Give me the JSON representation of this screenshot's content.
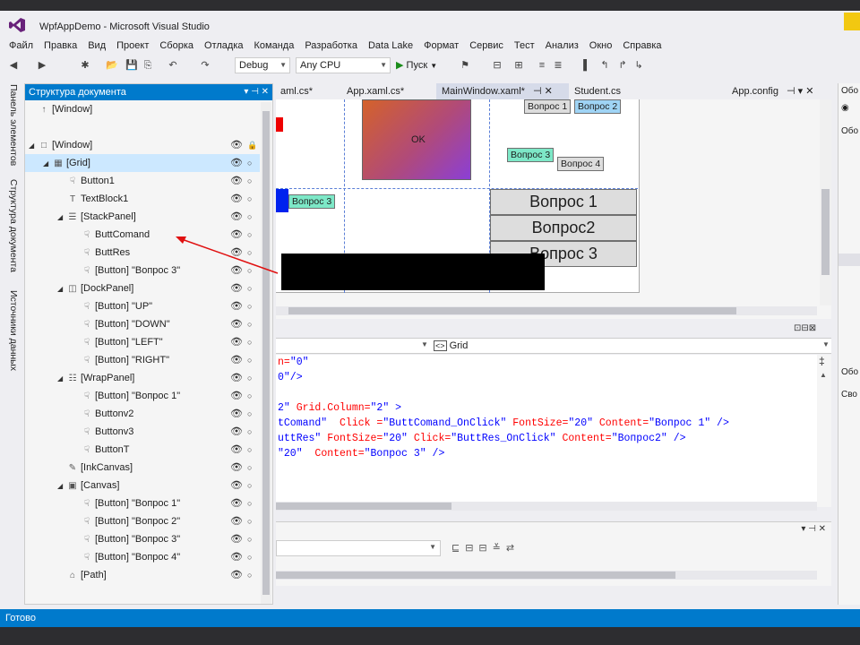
{
  "window": {
    "title": "WpfAppDemo - Microsoft Visual Studio"
  },
  "menu": [
    "Файл",
    "Правка",
    "Вид",
    "Проект",
    "Сборка",
    "Отладка",
    "Команда",
    "Разработка",
    "Data Lake",
    "Формат",
    "Сервис",
    "Тест",
    "Анализ",
    "Окно",
    "Справка"
  ],
  "toolbar": {
    "config": "Debug",
    "platform": "Any CPU",
    "run_label": "Пуск"
  },
  "vertical_tabs": [
    "Панель элементов",
    "Структура документа",
    "Источники данных"
  ],
  "outline": {
    "header": "Структура документа",
    "header_controls": "▾ ⊣ ✕",
    "items": [
      {
        "label": "[Window]",
        "indent": 0,
        "icon": "↑",
        "arrow": ""
      },
      {
        "label": "[Window]",
        "indent": 0,
        "icon": "□",
        "arrow": "◢"
      },
      {
        "label": "[Grid]",
        "indent": 1,
        "icon": "▦",
        "arrow": "◢"
      },
      {
        "label": "Button1",
        "indent": 2,
        "icon": "☟",
        "arrow": ""
      },
      {
        "label": "TextBlock1",
        "indent": 2,
        "icon": "T",
        "arrow": ""
      },
      {
        "label": "[StackPanel]",
        "indent": 2,
        "icon": "☰",
        "arrow": "◢"
      },
      {
        "label": "ButtComand",
        "indent": 3,
        "icon": "☟",
        "arrow": ""
      },
      {
        "label": "ButtRes",
        "indent": 3,
        "icon": "☟",
        "arrow": ""
      },
      {
        "label": "[Button] \"Вопрос 3\"",
        "indent": 3,
        "icon": "☟",
        "arrow": ""
      },
      {
        "label": "[DockPanel]",
        "indent": 2,
        "icon": "◫",
        "arrow": "◢"
      },
      {
        "label": "[Button] \"UP\"",
        "indent": 3,
        "icon": "☟",
        "arrow": ""
      },
      {
        "label": "[Button] \"DOWN\"",
        "indent": 3,
        "icon": "☟",
        "arrow": ""
      },
      {
        "label": "[Button] \"LEFT\"",
        "indent": 3,
        "icon": "☟",
        "arrow": ""
      },
      {
        "label": "[Button] \"RIGHT\"",
        "indent": 3,
        "icon": "☟",
        "arrow": ""
      },
      {
        "label": "[WrapPanel]",
        "indent": 2,
        "icon": "☷",
        "arrow": "◢"
      },
      {
        "label": "[Button] \"Вопрос 1\"",
        "indent": 3,
        "icon": "☟",
        "arrow": ""
      },
      {
        "label": "Buttonv2",
        "indent": 3,
        "icon": "☟",
        "arrow": ""
      },
      {
        "label": "Buttonv3",
        "indent": 3,
        "icon": "☟",
        "arrow": ""
      },
      {
        "label": "ButtonT",
        "indent": 3,
        "icon": "☟",
        "arrow": ""
      },
      {
        "label": "[InkCanvas]",
        "indent": 2,
        "icon": "✎",
        "arrow": ""
      },
      {
        "label": "[Canvas]",
        "indent": 2,
        "icon": "▣",
        "arrow": "◢"
      },
      {
        "label": "[Button] \"Вопрос 1\"",
        "indent": 3,
        "icon": "☟",
        "arrow": ""
      },
      {
        "label": "[Button] \"Вопрос 2\"",
        "indent": 3,
        "icon": "☟",
        "arrow": ""
      },
      {
        "label": "[Button] \"Вопрос 3\"",
        "indent": 3,
        "icon": "☟",
        "arrow": ""
      },
      {
        "label": "[Button] \"Вопрос 4\"",
        "indent": 3,
        "icon": "☟",
        "arrow": ""
      },
      {
        "label": "[Path]",
        "indent": 2,
        "icon": "⌂",
        "arrow": ""
      }
    ]
  },
  "tabs": {
    "t1": "aml.cs*",
    "t2": "App.xaml.cs*",
    "t3": "MainWindow.xaml*",
    "t3_ctl": "⊣ ✕",
    "t4": "Student.cs",
    "t5": "App.config",
    "t5_ctl": "⊣ ▾ ✕"
  },
  "designer": {
    "ok": "OK",
    "q1_small": "Вопрос 1",
    "q2_small": "Вопрос 2",
    "q3_small": "Вопрос 3",
    "q4_small": "Вопрос 4",
    "q3_left": "Вопрос 3",
    "big1": "Вопрос 1",
    "big2": "Вопрос2",
    "big3": "Вопрос 3"
  },
  "code_nav": {
    "element": "Grid"
  },
  "code": {
    "l1_a": "n=",
    "l1_v": "\"0\"",
    "l2_v": "0\"/>",
    "l3_a": "2\"",
    "l3_b": " Grid.Column=",
    "l3_c": "\"2\"",
    "l3_d": " >",
    "l4_a": "tComand\"",
    "l4_b": "  Click =",
    "l4_c": "\"ButtComand_OnClick\"",
    "l4_d": " FontSize=",
    "l4_e": "\"20\"",
    "l4_f": " Content=",
    "l4_g": "\"Вопрос 1\"",
    "l4_h": " />",
    "l5_a": "uttRes\"",
    "l5_b": " FontSize=",
    "l5_c": "\"20\"",
    "l5_d": " Click=",
    "l5_e": "\"ButtRes_OnClick\"",
    "l5_f": " Content=",
    "l5_g": "\"Вопрос2\"",
    "l5_h": " />",
    "l6_a": "\"20\"",
    "l6_b": "  Content=",
    "l6_c": "\"Вопрос 3\"",
    "l6_d": " />"
  },
  "props": {
    "p1": "Обо",
    "p2": "Обо",
    "p3": "Обо",
    "p4": "Сво"
  },
  "status": {
    "text": "Готово"
  },
  "colors": {
    "accent": "#007acc"
  }
}
